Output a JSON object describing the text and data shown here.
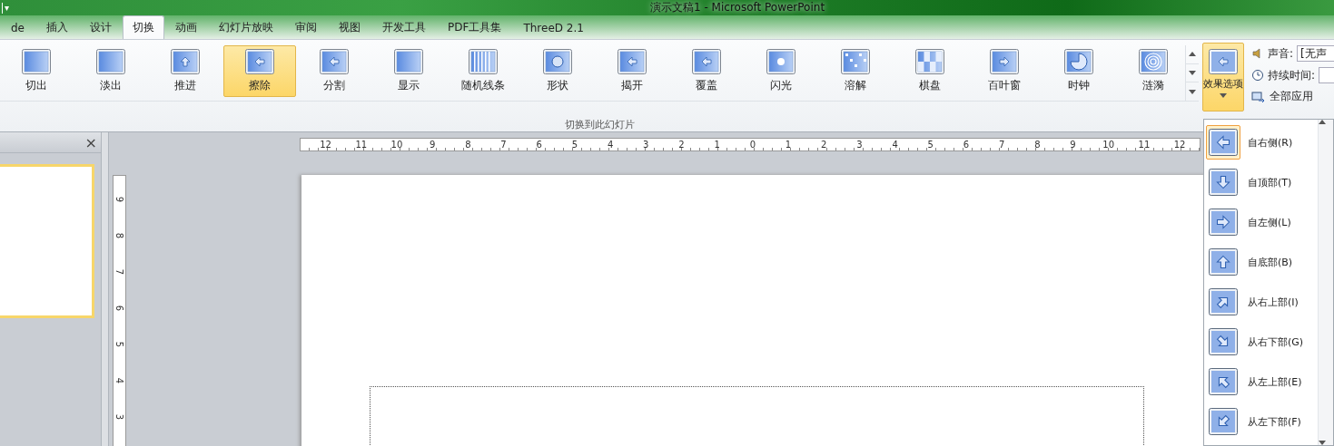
{
  "window": {
    "title": "演示文稿1 - Microsoft PowerPoint",
    "quick_access_caret": "▾"
  },
  "tabs": [
    {
      "label": "de",
      "selected": false
    },
    {
      "label": "插入",
      "selected": false
    },
    {
      "label": "设计",
      "selected": false
    },
    {
      "label": "切换",
      "selected": true
    },
    {
      "label": "动画",
      "selected": false
    },
    {
      "label": "幻灯片放映",
      "selected": false
    },
    {
      "label": "审阅",
      "selected": false
    },
    {
      "label": "视图",
      "selected": false
    },
    {
      "label": "开发工具",
      "selected": false
    },
    {
      "label": "PDF工具集",
      "selected": false
    },
    {
      "label": "ThreeD 2.1",
      "selected": false
    }
  ],
  "transitions": {
    "group_label": "切换到此幻灯片",
    "items": [
      {
        "label": "切出",
        "selected": false
      },
      {
        "label": "淡出",
        "selected": false
      },
      {
        "label": "推进",
        "selected": false
      },
      {
        "label": "擦除",
        "selected": true
      },
      {
        "label": "分割",
        "selected": false
      },
      {
        "label": "显示",
        "selected": false
      },
      {
        "label": "随机线条",
        "selected": false
      },
      {
        "label": "形状",
        "selected": false
      },
      {
        "label": "揭开",
        "selected": false
      },
      {
        "label": "覆盖",
        "selected": false
      },
      {
        "label": "闪光",
        "selected": false
      },
      {
        "label": "溶解",
        "selected": false
      },
      {
        "label": "棋盘",
        "selected": false
      },
      {
        "label": "百叶窗",
        "selected": false
      },
      {
        "label": "时钟",
        "selected": false
      },
      {
        "label": "涟漪",
        "selected": false
      }
    ]
  },
  "effect_options": {
    "label": "效果选项",
    "open": true
  },
  "timing": {
    "sound_label": "声音:",
    "sound_value": "[无声",
    "duration_label": "持续时间:",
    "apply_all": "全部应用"
  },
  "slides_panel": {
    "close": "×",
    "thumbnail_selected": true
  },
  "rulers": {
    "horizontal": [
      "12",
      "11",
      "10",
      "9",
      "8",
      "7",
      "6",
      "5",
      "4",
      "3",
      "2",
      "1",
      "0",
      "1",
      "2",
      "3",
      "4",
      "5",
      "6",
      "7",
      "8",
      "9",
      "10",
      "11",
      "12"
    ],
    "vertical": [
      "9",
      "8",
      "7",
      "6",
      "5",
      "4",
      "3"
    ]
  },
  "effect_menu": {
    "items": [
      {
        "label": "自右侧(R)",
        "selected": true
      },
      {
        "label": "自顶部(T)",
        "selected": false
      },
      {
        "label": "自左侧(L)",
        "selected": false
      },
      {
        "label": "自底部(B)",
        "selected": false
      },
      {
        "label": "从右上部(I)",
        "selected": false
      },
      {
        "label": "从右下部(G)",
        "selected": false
      },
      {
        "label": "从左上部(E)",
        "selected": false
      },
      {
        "label": "从左下部(F)",
        "selected": false
      }
    ]
  }
}
